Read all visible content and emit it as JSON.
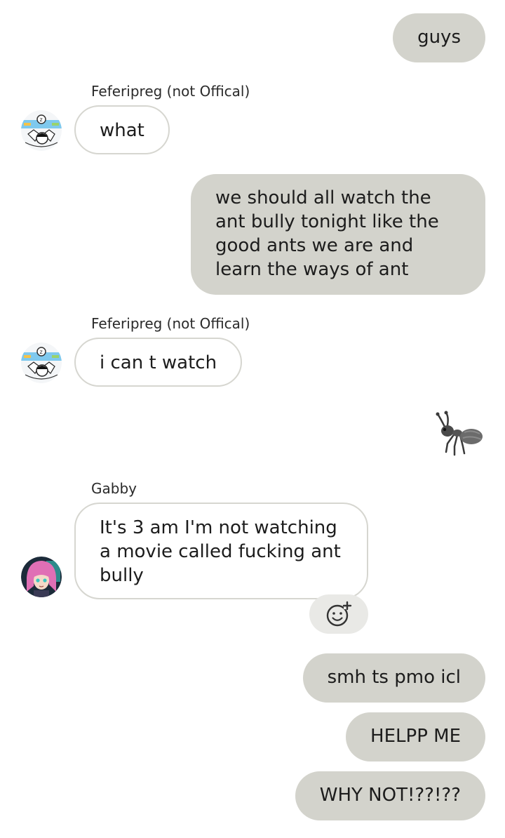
{
  "messages": {
    "m1": {
      "text": "guys"
    },
    "m2": {
      "sender": "Feferipreg (not Offical)",
      "text": "what"
    },
    "m3": {
      "text": "we should all watch the ant bully tonight like the good ants we are and learn the ways of ant"
    },
    "m4": {
      "sender": "Feferipreg (not Offical)",
      "text": "i can t watch"
    },
    "m5": {
      "emoji": "ant-emoji"
    },
    "m6": {
      "sender": "Gabby",
      "text": "It's 3 am I'm not watching a movie called fucking ant bully"
    },
    "m7": {
      "text": "smh ts pmo icl"
    },
    "m8": {
      "text": "HELPP ME"
    },
    "m9": {
      "text": "WHY NOT!??!??"
    }
  },
  "icons": {
    "add_reaction": "add-reaction-icon"
  },
  "colors": {
    "outgoing_bubble": "#d3d3cc",
    "incoming_border": "#d6d6d0",
    "reaction_button": "#e9e9e6"
  }
}
